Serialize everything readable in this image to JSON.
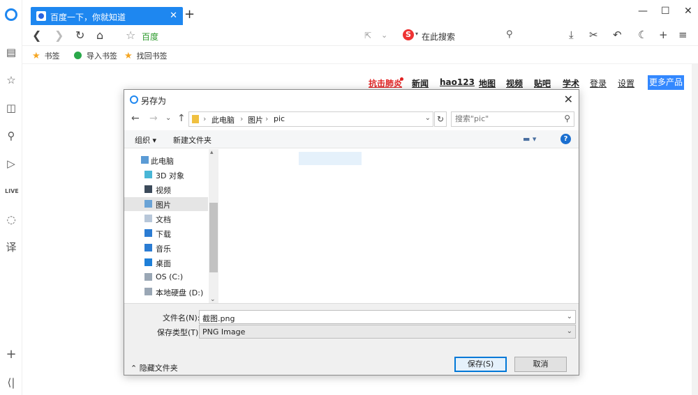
{
  "browser": {
    "tab_title": "百度一下，你就知道",
    "address_text": "百度",
    "search_placeholder": "在此搜索"
  },
  "bookmarks": [
    "书签",
    "导入书签",
    "找回书签"
  ],
  "baidu_nav": {
    "items": [
      "抗击肺炎",
      "新闻",
      "hao123",
      "地图",
      "视频",
      "贴吧",
      "学术",
      "登录",
      "设置"
    ],
    "more_button": "更多产品"
  },
  "dialog": {
    "title": "另存为",
    "path": [
      "此电脑",
      "图片",
      "pic"
    ],
    "search_placeholder": "搜索\"pic\"",
    "organize": "组织 ▾",
    "new_folder": "新建文件夹",
    "tree": [
      {
        "label": "此电脑",
        "icon": "pc-icon"
      },
      {
        "label": "3D 对象",
        "icon": "3d-objects-icon"
      },
      {
        "label": "视频",
        "icon": "video-icon"
      },
      {
        "label": "图片",
        "icon": "pictures-icon",
        "selected": true
      },
      {
        "label": "文档",
        "icon": "documents-icon"
      },
      {
        "label": "下载",
        "icon": "download-icon"
      },
      {
        "label": "音乐",
        "icon": "music-icon"
      },
      {
        "label": "桌面",
        "icon": "desktop-icon"
      },
      {
        "label": "OS (C:)",
        "icon": "drive-c-icon"
      },
      {
        "label": "本地硬盘 (D:)",
        "icon": "drive-d-icon"
      }
    ],
    "filename_label": "文件名(N):",
    "filename_value": "截图.png",
    "filetype_label": "保存类型(T):",
    "filetype_value": "PNG Image",
    "hide_folders": "隐藏文件夹",
    "save_button": "保存(S)",
    "cancel_button": "取消"
  },
  "colors": {
    "accent": "#1e87f0",
    "baidu_more": "#3388ff",
    "red_link": "#e02222"
  }
}
